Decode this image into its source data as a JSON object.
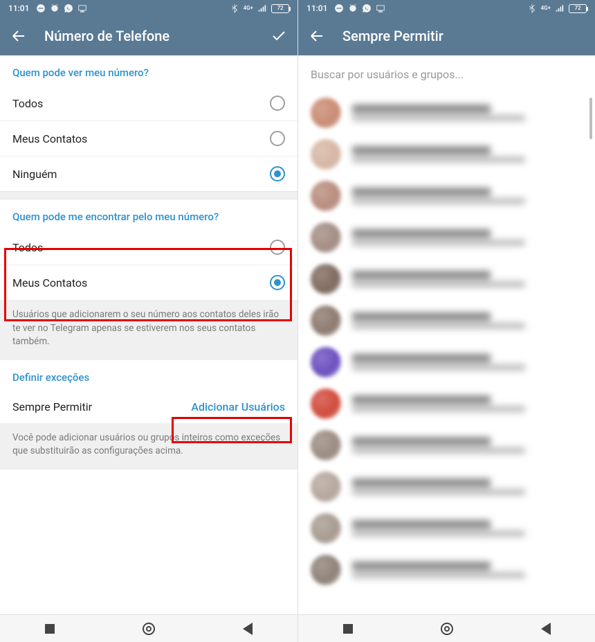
{
  "status": {
    "time": "11:01",
    "battery_pct": "72"
  },
  "left": {
    "title": "Número de Telefone",
    "section1_title": "Quem pode ver meu número?",
    "opt_everybody": "Todos",
    "opt_contacts": "Meus Contatos",
    "opt_nobody": "Ninguém",
    "section2_title": "Quem pode me encontrar pelo meu número?",
    "opt2_everybody": "Todos",
    "opt2_contacts": "Meus Contatos",
    "helper1": "Usuários que adicionarem o seu número aos contatos deles irão te ver no Telegram apenas se estiverem nos seus contatos também.",
    "section3_title": "Definir exceções",
    "always_allow": "Sempre Permitir",
    "add_users": "Adicionar Usuários",
    "helper2": "Você pode adicionar usuários ou grupos inteiros como exceções que substituirão as configurações acima."
  },
  "right": {
    "title": "Sempre Permitir",
    "search_placeholder": "Buscar por usuários e grupos...",
    "contact_avatars": [
      "#c98b73",
      "#d6b6a4",
      "#b88c7d",
      "#a38c82",
      "#7f6a5e",
      "#8d7a6e",
      "#6b4fbf",
      "#d14a3a",
      "#9a8b80",
      "#b5a79c",
      "#a79b90",
      "#8f8278"
    ]
  }
}
